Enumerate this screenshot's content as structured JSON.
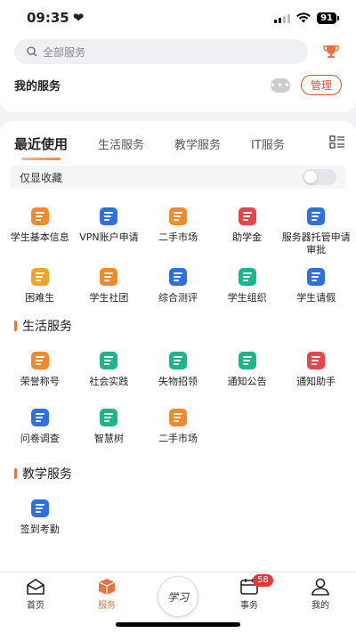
{
  "status": {
    "time": "09:35",
    "battery": "91"
  },
  "search": {
    "placeholder": "全部服务"
  },
  "my_services": {
    "title": "我的服务",
    "manage": "管理",
    "more": "•••"
  },
  "tabs": [
    "最近使用",
    "生活服务",
    "教学服务",
    "IT服务"
  ],
  "fav_toggle_label": "仅显收藏",
  "recent": [
    {
      "label": "学生基本信息",
      "icon": "student-info-icon",
      "color": "#f08a2b"
    },
    {
      "label": "VPN账户申请",
      "icon": "vpn-icon",
      "color": "#2f6fe0"
    },
    {
      "label": "二手市场",
      "icon": "market-icon",
      "color": "#f08a2b"
    },
    {
      "label": "助学金",
      "icon": "ticket-icon",
      "color": "#e9444c"
    },
    {
      "label": "服务器托管申请审批",
      "icon": "server-icon",
      "color": "#2f6fe0"
    },
    {
      "label": "困难生",
      "icon": "person-icon",
      "color": "#f0a42b"
    },
    {
      "label": "学生社团",
      "icon": "club-icon",
      "color": "#f08a2b"
    },
    {
      "label": "综合测评",
      "icon": "evaluation-icon",
      "color": "#2f6fe0"
    },
    {
      "label": "学生组织",
      "icon": "organization-icon",
      "color": "#1fb48a"
    },
    {
      "label": "学生请假",
      "icon": "leave-icon",
      "color": "#2f6fe0"
    }
  ],
  "life_section": {
    "title": "生活服务",
    "items": [
      {
        "label": "荣誉称号",
        "icon": "honor-icon",
        "color": "#f08a2b"
      },
      {
        "label": "社会实践",
        "icon": "practice-icon",
        "color": "#1fb48a"
      },
      {
        "label": "失物招领",
        "icon": "lost-found-icon",
        "color": "#1fb48a"
      },
      {
        "label": "通知公告",
        "icon": "notice-icon",
        "color": "#1fb48a"
      },
      {
        "label": "通知助手",
        "icon": "notify-helper-icon",
        "color": "#e9444c"
      },
      {
        "label": "问卷调查",
        "icon": "survey-icon",
        "color": "#2f6fe0"
      },
      {
        "label": "智慧树",
        "icon": "bulb-icon",
        "color": "#1fb48a"
      },
      {
        "label": "二手市场",
        "icon": "market-icon",
        "color": "#f08a2b"
      }
    ]
  },
  "teach_section": {
    "title": "教学服务",
    "items": [
      {
        "label": "签到考勤",
        "icon": "checkin-icon",
        "color": "#2f6fe0"
      }
    ]
  },
  "tabbar": [
    {
      "label": "首页",
      "icon": "home-icon"
    },
    {
      "label": "服务",
      "icon": "box-icon"
    },
    {
      "label": "学习",
      "icon": "study-logo"
    },
    {
      "label": "事务",
      "icon": "calendar-icon",
      "badge": "58"
    },
    {
      "label": "我的",
      "icon": "user-icon"
    }
  ]
}
